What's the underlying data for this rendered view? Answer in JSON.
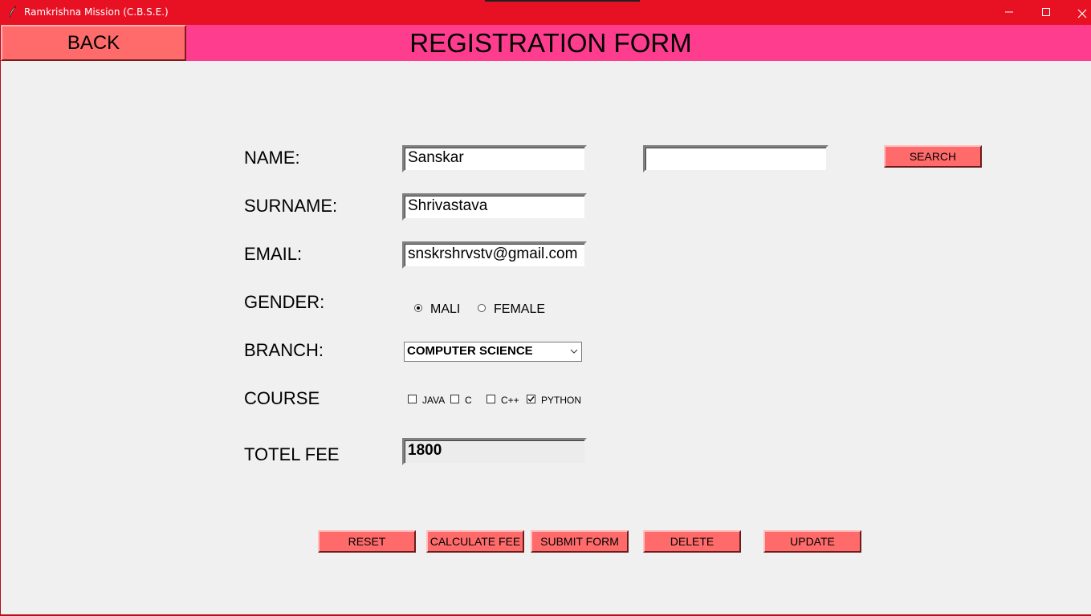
{
  "window": {
    "title": "Ramkrishna Mission (C.B.S.E.)",
    "controls": {
      "minimize": "—",
      "maximize": "☐",
      "close": "✕"
    },
    "app_icon": "feather-icon",
    "title_bar_color": "#e81123"
  },
  "header": {
    "back_label": "BACK",
    "title": "REGISTRATION FORM",
    "band_color": "#ff3d8f",
    "button_color": "#ff6b6b"
  },
  "form": {
    "name_label": "NAME:",
    "name_value": "Sanskar",
    "surname_label": "SURNAME:",
    "surname_value": "Shrivastava",
    "email_label": "EMAIL:",
    "email_value": "snskrshrvstv@gmail.com",
    "gender_label": "GENDER:",
    "gender_options": [
      {
        "label": "MALI",
        "selected": true
      },
      {
        "label": "FEMALE",
        "selected": false
      }
    ],
    "branch_label": "BRANCH:",
    "branch_value": "COMPUTER SCIENCE",
    "course_label": "COURSE",
    "courses": [
      {
        "label": "JAVA",
        "checked": false
      },
      {
        "label": "C",
        "checked": false
      },
      {
        "label": "C++",
        "checked": false
      },
      {
        "label": "PYTHON",
        "checked": true
      }
    ],
    "fee_label": "TOTEL FEE",
    "fee_value": "1800"
  },
  "search": {
    "value": "",
    "button_label": "SEARCH"
  },
  "actions": {
    "reset": "RESET",
    "calculate": "CALCULATE FEE",
    "submit": "SUBMIT FORM",
    "delete": "DELETE",
    "update": "UPDATE"
  }
}
